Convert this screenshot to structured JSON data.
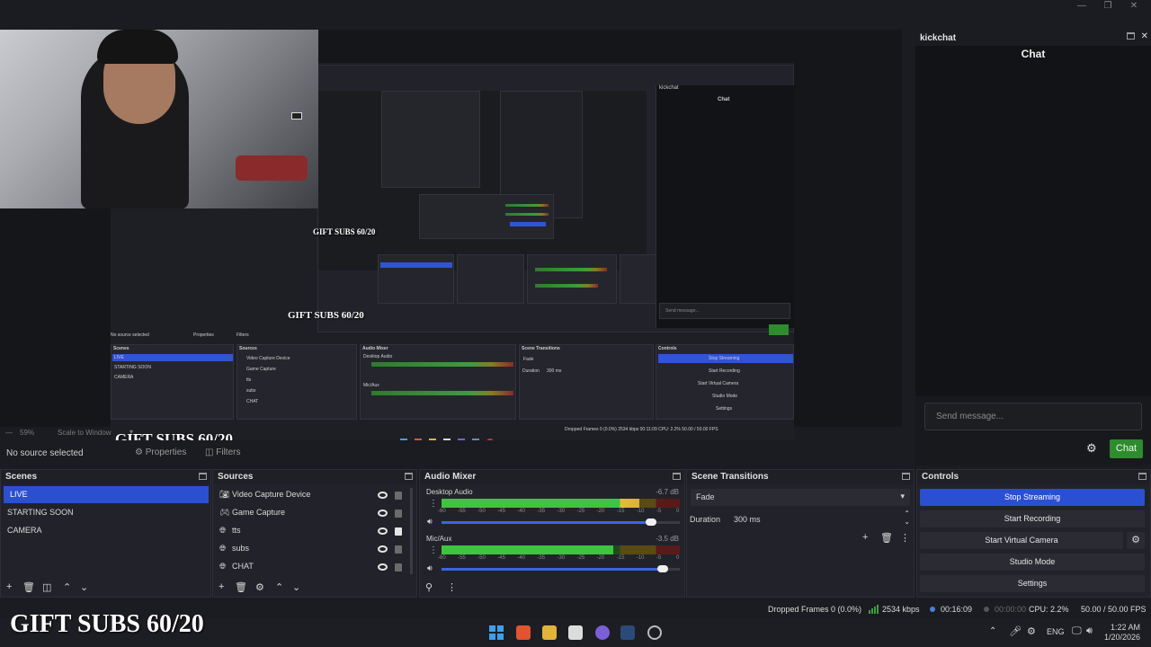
{
  "window_controls": [
    "—",
    "❐",
    "✕"
  ],
  "overlay": {
    "gift_text": "GIFT SUBS 60/20"
  },
  "nested": {
    "no_source": "No source selected",
    "properties": "Properties",
    "filters": "Filters",
    "scenes_title": "Scenes",
    "sources_title": "Sources",
    "mixer_title": "Audio Mixer",
    "transitions_title": "Scene Transitions",
    "controls_title": "Controls",
    "scenes": [
      "LIVE",
      "STARTING SOON",
      "CAMERA"
    ],
    "sources": [
      "Video Capture Device",
      "Game Capture",
      "tts",
      "subs",
      "CHAT"
    ],
    "mixer": [
      "Desktop Audio",
      "Mic/Aux"
    ],
    "transition": "Fade",
    "duration_label": "Duration",
    "duration": "300 ms",
    "controls": [
      "Stop Streaming",
      "Start Recording",
      "Start Virtual Camera",
      "Studio Mode",
      "Settings"
    ],
    "kickchat": "kickchat",
    "chat": "Chat",
    "send": "Send message...",
    "chat_btn": "Chat",
    "status": "Dropped Frames 0 (0.0%)   2534 kbps   00:11:09   CPU: 2.2%   50.00 / 50.00 FPS",
    "zoom": "59%",
    "scale": "Scale to Window"
  },
  "scalebar": {
    "zoom": "59%",
    "mode": "Scale to Window"
  },
  "propbar": {
    "no_source": "No source selected",
    "properties": "Properties",
    "filters": "Filters"
  },
  "scenes": {
    "title": "Scenes",
    "items": [
      "LIVE",
      "STARTING SOON",
      "CAMERA"
    ],
    "selected": "LIVE"
  },
  "sources": {
    "title": "Sources",
    "items": [
      {
        "label": "Video Capture Device",
        "icon": "camera-icon"
      },
      {
        "label": "Game Capture",
        "icon": "gamepad-icon"
      },
      {
        "label": "tts",
        "icon": "globe-icon"
      },
      {
        "label": "subs",
        "icon": "globe-icon"
      },
      {
        "label": "CHAT",
        "icon": "globe-icon"
      }
    ]
  },
  "mixer": {
    "title": "Audio Mixer",
    "tracks": [
      {
        "name": "Desktop Audio",
        "db": "-6.7 dB",
        "level": 0.83,
        "volume": 0.88
      },
      {
        "name": "Mic/Aux",
        "db": "-3.5 dB",
        "level": 0.72,
        "volume": 0.93
      }
    ],
    "scale": [
      "-60",
      "-55",
      "-50",
      "-45",
      "-40",
      "-35",
      "-30",
      "-25",
      "-20",
      "-15",
      "-10",
      "-5",
      "0"
    ]
  },
  "transitions": {
    "title": "Scene Transitions",
    "selected": "Fade",
    "duration_label": "Duration",
    "duration": "300 ms"
  },
  "controls": {
    "title": "Controls",
    "stop_streaming": "Stop Streaming",
    "start_recording": "Start Recording",
    "start_virtual_camera": "Start Virtual Camera",
    "studio_mode": "Studio Mode",
    "settings": "Settings"
  },
  "chat": {
    "title": "kickchat",
    "heading": "Chat",
    "placeholder": "Send message...",
    "button": "Chat"
  },
  "status": {
    "dropped_frames": "Dropped Frames 0 (0.0%)",
    "bitrate": "2534 kbps",
    "stream_time": "00:16:09",
    "record_time": "00:00:00",
    "cpu": "CPU: 2.2%",
    "fps": "50.00 / 50.00 FPS"
  },
  "taskbar": {
    "language": "ENG",
    "time": "1:22 AM",
    "date": "1/20/2026"
  },
  "colors": {
    "accent": "#2b4fd1",
    "chat_green": "#2e8b2e",
    "meter_green": "#3f9c3f"
  }
}
